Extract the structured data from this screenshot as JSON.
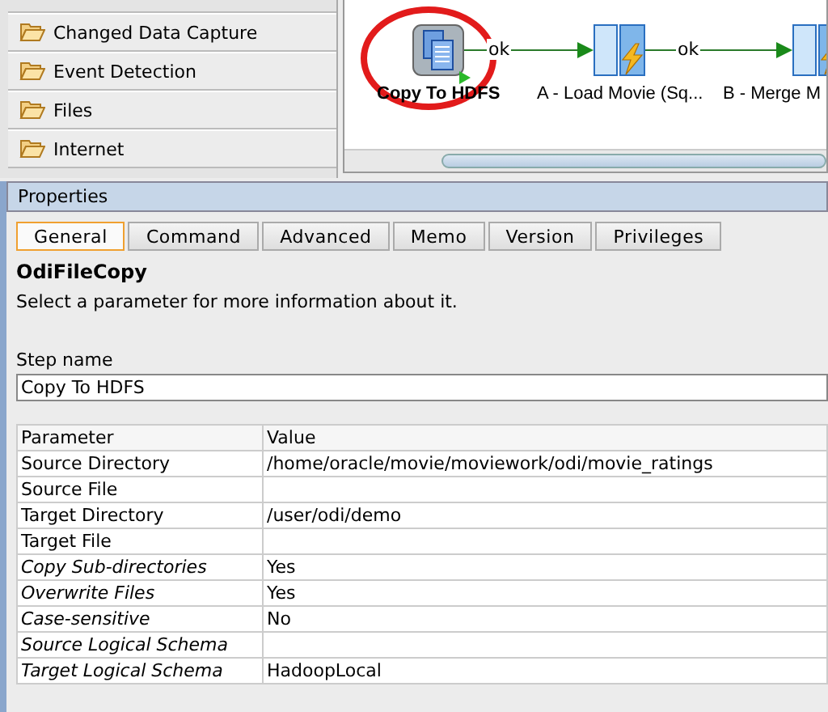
{
  "palette": {
    "items": [
      {
        "label": "Changed Data Capture"
      },
      {
        "label": "Event Detection"
      },
      {
        "label": "Files"
      },
      {
        "label": "Internet"
      }
    ]
  },
  "diagram": {
    "nodes": [
      {
        "label": "Copy To HDFS",
        "kind": "copy",
        "selected": true
      },
      {
        "label": "A - Load Movie (Sq...",
        "kind": "step",
        "selected": false
      },
      {
        "label": "B - Merge M",
        "kind": "step",
        "selected": false
      }
    ],
    "links": [
      {
        "label": "ok"
      },
      {
        "label": "ok"
      }
    ]
  },
  "properties": {
    "title": "Properties",
    "tabs": [
      {
        "label": "General",
        "selected": true
      },
      {
        "label": "Command",
        "selected": false
      },
      {
        "label": "Advanced",
        "selected": false
      },
      {
        "label": "Memo",
        "selected": false
      },
      {
        "label": "Version",
        "selected": false
      },
      {
        "label": "Privileges",
        "selected": false
      }
    ],
    "tool_name": "OdiFileCopy",
    "description": "Select a parameter for more information about it.",
    "step_name": {
      "label": "Step name",
      "value": "Copy To HDFS"
    },
    "table": {
      "columns": [
        "Parameter",
        "Value"
      ],
      "rows": [
        {
          "parameter": "Source Directory",
          "value": "/home/oracle/movie/moviework/odi/movie_ratings",
          "optional": false
        },
        {
          "parameter": "Source File",
          "value": "",
          "optional": false
        },
        {
          "parameter": "Target Directory",
          "value": "/user/odi/demo",
          "optional": false
        },
        {
          "parameter": "Target File",
          "value": "",
          "optional": false
        },
        {
          "parameter": "Copy Sub-directories",
          "value": "Yes",
          "optional": true
        },
        {
          "parameter": "Overwrite Files",
          "value": "Yes",
          "optional": true
        },
        {
          "parameter": "Case-sensitive",
          "value": "No",
          "optional": true
        },
        {
          "parameter": "Source Logical Schema",
          "value": "",
          "optional": true
        },
        {
          "parameter": "Target Logical Schema",
          "value": "HadoopLocal",
          "optional": true
        }
      ]
    }
  }
}
